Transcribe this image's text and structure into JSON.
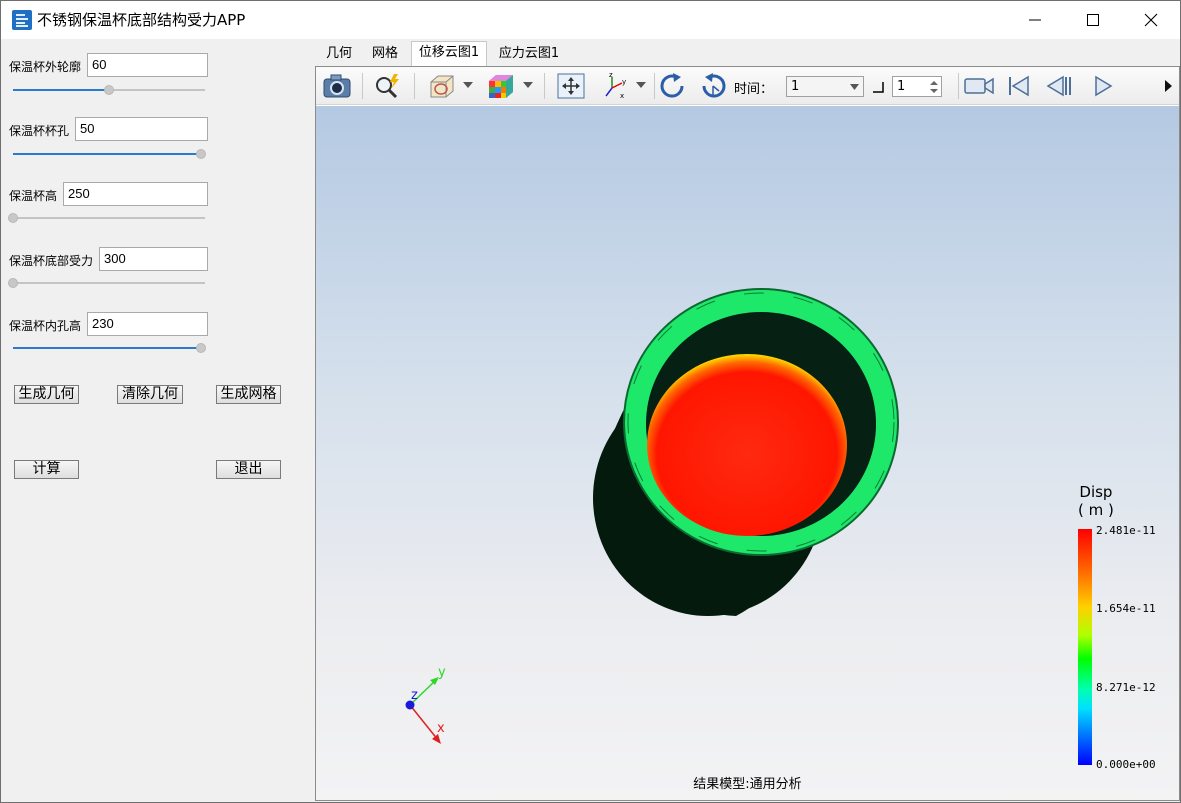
{
  "window": {
    "title": "不锈钢保温杯底部结构受力APP",
    "min_icon": "minimize-icon",
    "max_icon": "maximize-icon",
    "close_icon": "close-icon"
  },
  "params": [
    {
      "label": "保温杯外轮廓",
      "value": "60",
      "slider": 0.5
    },
    {
      "label": "保温杯杯孔",
      "value": "50",
      "slider": 1.0
    },
    {
      "label": "保温杯高",
      "value": "250",
      "slider": 0.0
    },
    {
      "label": "保温杯底部受力",
      "value": "300",
      "slider": 0.0
    },
    {
      "label": "保温杯内孔高",
      "value": "230",
      "slider": 1.0
    }
  ],
  "buttons": {
    "gen_geometry": "生成几何",
    "clear_geometry": "清除几何",
    "gen_mesh": "生成网格",
    "compute": "计算",
    "exit": "退出"
  },
  "tabs": [
    "几何",
    "网格",
    "位移云图1",
    "应力云图1"
  ],
  "active_tab": 2,
  "toolbar": {
    "time_label": "时间：",
    "time_value": "1",
    "step_value": "1",
    "icons": [
      "camera-icon",
      "zoom-icon",
      "display-mode-icon",
      "color-cube-icon",
      "fit-view-icon",
      "axes-icon",
      "rotate-cw-icon",
      "rotate-ccw-icon",
      "record-icon",
      "first-frame-icon",
      "prev-frame-icon",
      "play-icon"
    ]
  },
  "legend": {
    "title": "Disp",
    "unit": "( m )",
    "ticks": [
      "2.481e-11",
      "1.654e-11",
      "8.271e-12",
      "0.000e+00"
    ]
  },
  "axes": {
    "x": "x",
    "y": "y",
    "z": "z"
  },
  "footer": "结果模型:通用分析",
  "colors": {
    "ring": "#1ee86a",
    "contour_max": "#ff0000",
    "body": "#041a0d"
  }
}
